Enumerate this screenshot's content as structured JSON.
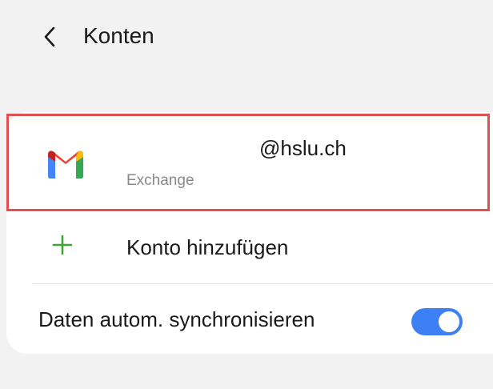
{
  "header": {
    "title": "Konten",
    "back_icon": "chevron-left-icon"
  },
  "accounts": [
    {
      "icon": "gmail-icon",
      "email": "@hslu.ch",
      "type": "Exchange",
      "highlighted": true
    }
  ],
  "add_account": {
    "icon": "plus-icon",
    "label": "Konto hinzufügen"
  },
  "sync": {
    "label": "Daten autom. synchronisieren",
    "enabled": true
  },
  "colors": {
    "background": "#f2f2f2",
    "card": "#ffffff",
    "highlight": "#e15050",
    "accent": "#3d7ff5",
    "plus": "#3aa832",
    "secondary_text": "#888888"
  }
}
